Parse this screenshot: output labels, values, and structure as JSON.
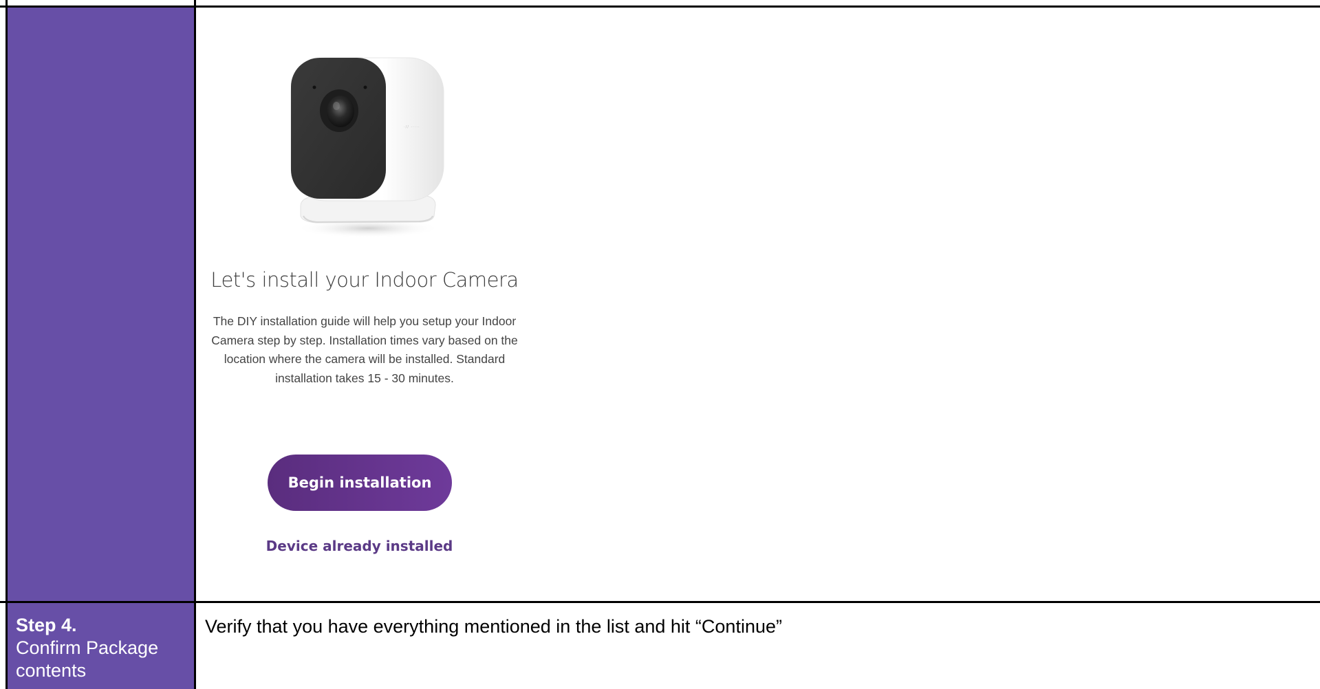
{
  "install_screen": {
    "title": "Let's install your Indoor Camera",
    "description": "The DIY installation guide will help you setup your Indoor Camera step by step. Installation times vary based on the location where the camera will be installed. Standard installation takes 15 - 30 minutes.",
    "begin_button": "Begin installation",
    "already_installed_link": "Device already installed",
    "camera_image": "indoor-camera-product-image"
  },
  "step_row": {
    "step_number": "Step 4.",
    "step_name": "Confirm Package contents",
    "instruction": "Verify that you have everything mentioned in the list and hit “Continue”"
  },
  "colors": {
    "step_column": "#674fa7",
    "button_gradient_start": "#5a2d7e",
    "button_gradient_end": "#6e3a9a",
    "link_text": "#5b3a86"
  }
}
